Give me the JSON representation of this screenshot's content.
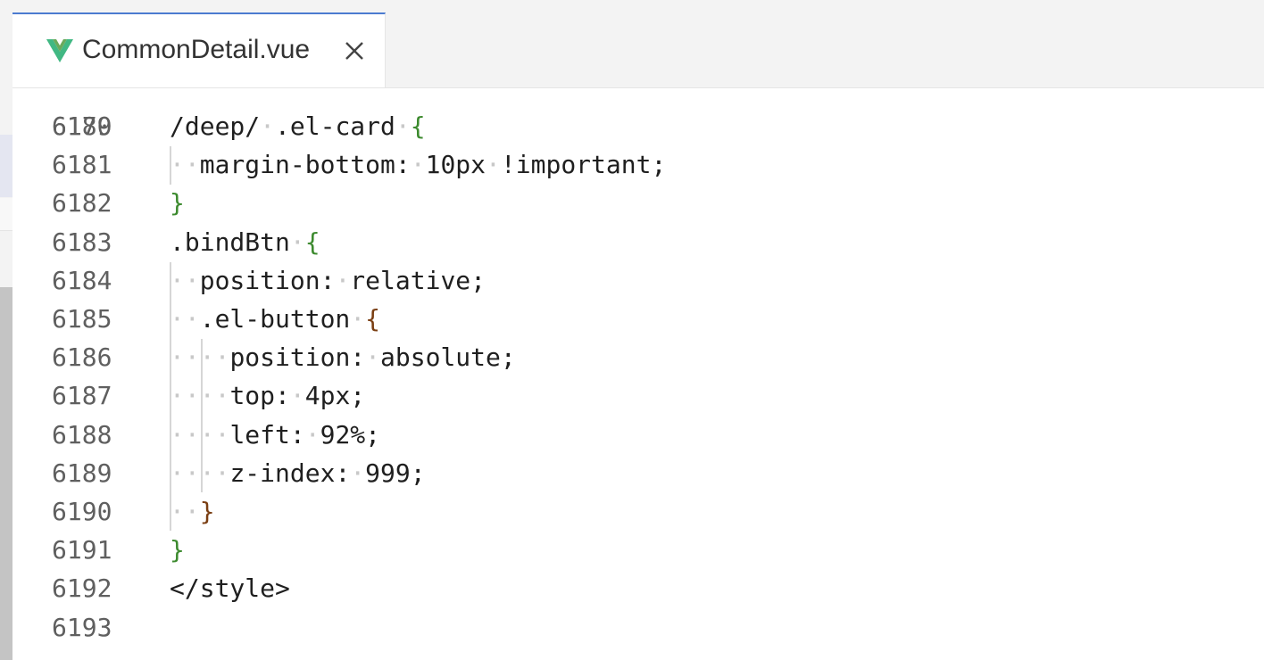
{
  "tab": {
    "file_name": "CommonDetail.vue",
    "icon": "vue-icon",
    "close_icon": "close-icon"
  },
  "editor": {
    "partial_line_number": "6179",
    "lines": [
      {
        "number": "6180",
        "indent": "",
        "text": "/deep/",
        "rest": ".el-card",
        "brace": "{",
        "brace_color": "green"
      },
      {
        "number": "6181",
        "indent": "··",
        "text": "margin-bottom:",
        "rest": "10px·!important;"
      },
      {
        "number": "6182",
        "indent": "",
        "text": "}",
        "brace_color": "green"
      },
      {
        "number": "6183",
        "indent": "",
        "text": ".bindBtn",
        "brace": "{",
        "brace_color": "green"
      },
      {
        "number": "6184",
        "indent": "··",
        "text": "position:",
        "rest": "relative;"
      },
      {
        "number": "6185",
        "indent": "··",
        "text": ".el-button",
        "brace": "{",
        "brace_color": "brown"
      },
      {
        "number": "6186",
        "indent": "····",
        "text": "position:",
        "rest": "absolute;"
      },
      {
        "number": "6187",
        "indent": "····",
        "text": "top:",
        "rest": "4px;"
      },
      {
        "number": "6188",
        "indent": "····",
        "text": "left:",
        "rest": "92%;"
      },
      {
        "number": "6189",
        "indent": "····",
        "text": "z-index:",
        "rest": "999;"
      },
      {
        "number": "6190",
        "indent": "··",
        "text": "}",
        "brace_color": "brown"
      },
      {
        "number": "6191",
        "indent": "",
        "text": "}",
        "brace_color": "green"
      },
      {
        "number": "6192",
        "indent": "",
        "text": "</style>"
      },
      {
        "number": "6193",
        "indent": "",
        "text": ""
      }
    ]
  },
  "colors": {
    "accent": "#4b7bd0",
    "brace_green": "#3c8a2e",
    "brace_brown": "#7a3e12",
    "whitespace_dots": "#c8c8c8",
    "line_number": "#5f5f5f",
    "vue_green": "#41b883",
    "vue_dark": "#35495e"
  }
}
